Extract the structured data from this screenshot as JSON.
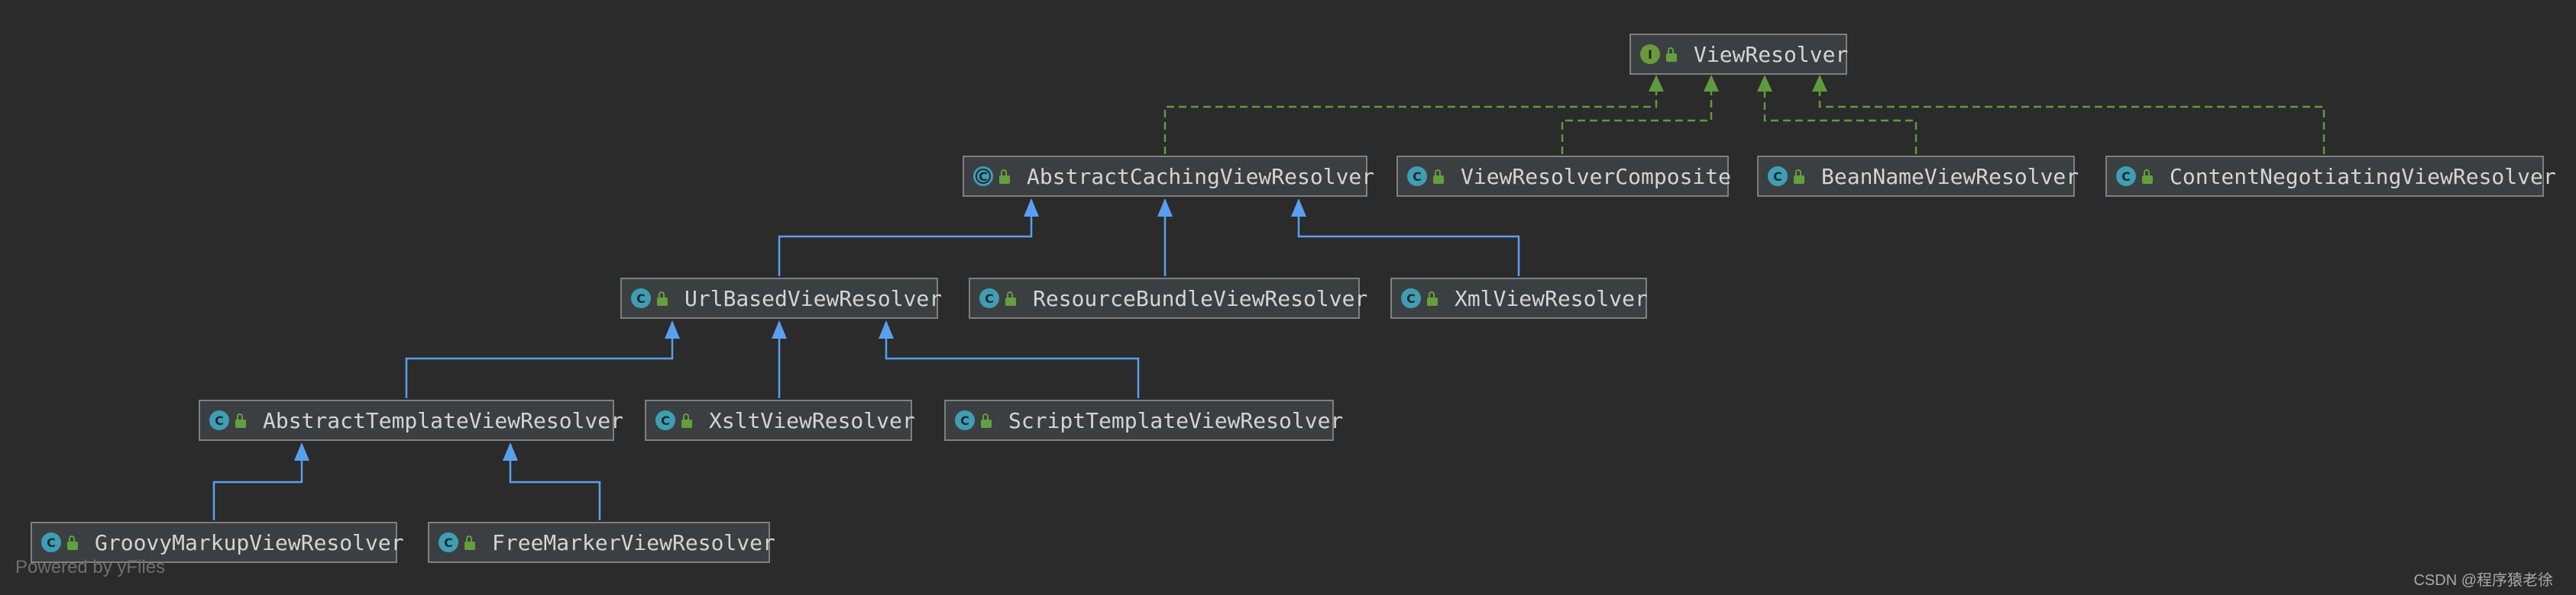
{
  "diagram": {
    "nodes": {
      "view_resolver": {
        "label": "ViewResolver",
        "kind": "interface"
      },
      "abstract_caching": {
        "label": "AbstractCachingViewResolver",
        "kind": "abstract"
      },
      "composite": {
        "label": "ViewResolverComposite",
        "kind": "class"
      },
      "bean_name": {
        "label": "BeanNameViewResolver",
        "kind": "class"
      },
      "content_negotiating": {
        "label": "ContentNegotiatingViewResolver",
        "kind": "class"
      },
      "url_based": {
        "label": "UrlBasedViewResolver",
        "kind": "class"
      },
      "resource_bundle": {
        "label": "ResourceBundleViewResolver",
        "kind": "class"
      },
      "xml": {
        "label": "XmlViewResolver",
        "kind": "class"
      },
      "abstract_template": {
        "label": "AbstractTemplateViewResolver",
        "kind": "class"
      },
      "xslt": {
        "label": "XsltViewResolver",
        "kind": "class"
      },
      "script_template": {
        "label": "ScriptTemplateViewResolver",
        "kind": "class"
      },
      "groovy_markup": {
        "label": "GroovyMarkupViewResolver",
        "kind": "class"
      },
      "freemarker": {
        "label": "FreeMarkerViewResolver",
        "kind": "class"
      }
    },
    "edges": [
      {
        "from": "abstract_caching",
        "to": "view_resolver",
        "type": "implements"
      },
      {
        "from": "composite",
        "to": "view_resolver",
        "type": "implements"
      },
      {
        "from": "bean_name",
        "to": "view_resolver",
        "type": "implements"
      },
      {
        "from": "content_negotiating",
        "to": "view_resolver",
        "type": "implements"
      },
      {
        "from": "url_based",
        "to": "abstract_caching",
        "type": "extends"
      },
      {
        "from": "resource_bundle",
        "to": "abstract_caching",
        "type": "extends"
      },
      {
        "from": "xml",
        "to": "abstract_caching",
        "type": "extends"
      },
      {
        "from": "abstract_template",
        "to": "url_based",
        "type": "extends"
      },
      {
        "from": "xslt",
        "to": "url_based",
        "type": "extends"
      },
      {
        "from": "script_template",
        "to": "url_based",
        "type": "extends"
      },
      {
        "from": "groovy_markup",
        "to": "abstract_template",
        "type": "extends"
      },
      {
        "from": "freemarker",
        "to": "abstract_template",
        "type": "extends"
      }
    ],
    "colors": {
      "background": "#2b2b2b",
      "node_fill": "#3c3f41",
      "implements_edge": "#5f9a3f",
      "extends_edge": "#5a9ef0"
    },
    "icons": {
      "class": "class-c-icon",
      "interface": "interface-i-icon",
      "abstract": "abstract-class-icon",
      "visibility": "public-lock-icon"
    }
  },
  "footer": {
    "powered_by": "Powered by yFiles",
    "watermark": "CSDN @程序猿老徐"
  }
}
